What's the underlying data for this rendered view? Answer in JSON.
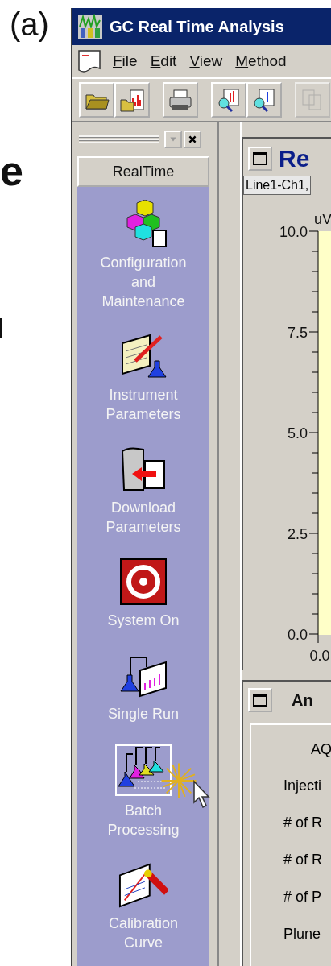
{
  "figure_label": "(a)",
  "side_fragments": [
    {
      "text": "e",
      "kind": "bold"
    },
    {
      "text": "l",
      "kind": "plain"
    }
  ],
  "window": {
    "title": "GC Real Time Analysis"
  },
  "menu": [
    "File",
    "Edit",
    "View",
    "Method"
  ],
  "toolbar": [
    {
      "kind": "open-folder",
      "disabled": false
    },
    {
      "kind": "folder-chart",
      "disabled": false
    },
    {
      "kind": "printer",
      "disabled": false
    },
    {
      "kind": "search-chart",
      "disabled": false
    },
    {
      "kind": "search-doc",
      "disabled": false
    },
    {
      "kind": "copy",
      "disabled": true
    }
  ],
  "sidebar": {
    "tab": "RealTime",
    "items": [
      {
        "label": "Configuration and Maintenance",
        "kind": "cubes",
        "clicked": false
      },
      {
        "label": "Instrument Parameters",
        "kind": "instrument",
        "clicked": false
      },
      {
        "label": "Download Parameters",
        "kind": "download",
        "clicked": false
      },
      {
        "label": "System On",
        "kind": "power",
        "clicked": false
      },
      {
        "label": "Single Run",
        "kind": "single-run",
        "clicked": false
      },
      {
        "label": "Batch Processing",
        "kind": "batch",
        "clicked": true
      },
      {
        "label": "Calibration Curve",
        "kind": "calibration",
        "clicked": false
      }
    ]
  },
  "chart_panel": {
    "title": "Re",
    "channel": "Line1-Ch1,",
    "y_unit": "uV",
    "y_tick_labels": [
      "10.0",
      "7.5",
      "5.0",
      "2.5",
      "0.0"
    ],
    "x_tick_label": "0.0"
  },
  "analysis_panel": {
    "title": "An",
    "header": "AQ",
    "rows": [
      "Injecti",
      "# of R",
      "# of R",
      "# of P",
      "Plune"
    ]
  }
}
